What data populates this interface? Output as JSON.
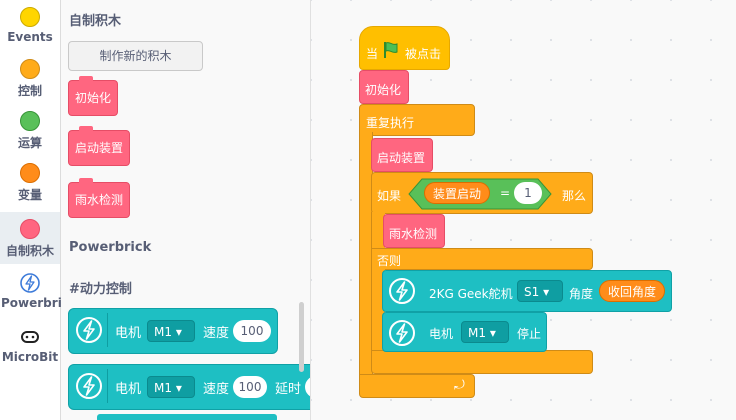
{
  "categories": [
    {
      "label": "Events",
      "color": "#ffd500",
      "border": "#ccaa00"
    },
    {
      "label": "控制",
      "color": "#ffab19",
      "border": "#cf8b17"
    },
    {
      "label": "运算",
      "color": "#59c059",
      "border": "#389438"
    },
    {
      "label": "变量",
      "color": "#ff8c1a",
      "border": "#db6e00"
    },
    {
      "label": "自制积木",
      "color": "#ff6680",
      "border": "#e64d66"
    },
    {
      "label": "Powerbrick",
      "icon": "lightning-icon"
    },
    {
      "label": "MicroBit",
      "icon": "microbit-icon"
    }
  ],
  "flyout": {
    "section_title": "自制积木",
    "make_block_button": "制作新的积木",
    "custom_blocks": [
      "初始化",
      "启动装置",
      "雨水检测"
    ],
    "powerbrick_title": "Powerbrick",
    "motor_title": "#动力控制",
    "motor_block_1": {
      "label": "电机",
      "port": "M1",
      "speed_label": "速度",
      "speed": "100"
    },
    "motor_block_2": {
      "label": "电机",
      "port": "M1",
      "speed_label": "速度",
      "speed": "100",
      "delay_label": "延时"
    }
  },
  "script": {
    "hat": {
      "prefix": "当",
      "suffix": "被点击"
    },
    "init": "初始化",
    "forever": "重复执行",
    "start_device": "启动装置",
    "if": {
      "if_label": "如果",
      "var_name": "装置启动",
      "op": "=",
      "value": "1",
      "then_label": "那么",
      "then_block": "雨水检测",
      "else_label": "否则"
    },
    "servo": {
      "label": "2KG Geek舵机",
      "port": "S1",
      "angle_label": "角度",
      "angle_value": "收回角度"
    },
    "stop_motor": {
      "label": "电机",
      "port": "M1",
      "action": "停止"
    }
  },
  "colors": {
    "events": "#ffbf00",
    "control": "#ffab19",
    "operators": "#59c059",
    "variables": "#ff8c1a",
    "my_blocks": "#ff6680",
    "powerbrick": "#1ebfc3"
  }
}
